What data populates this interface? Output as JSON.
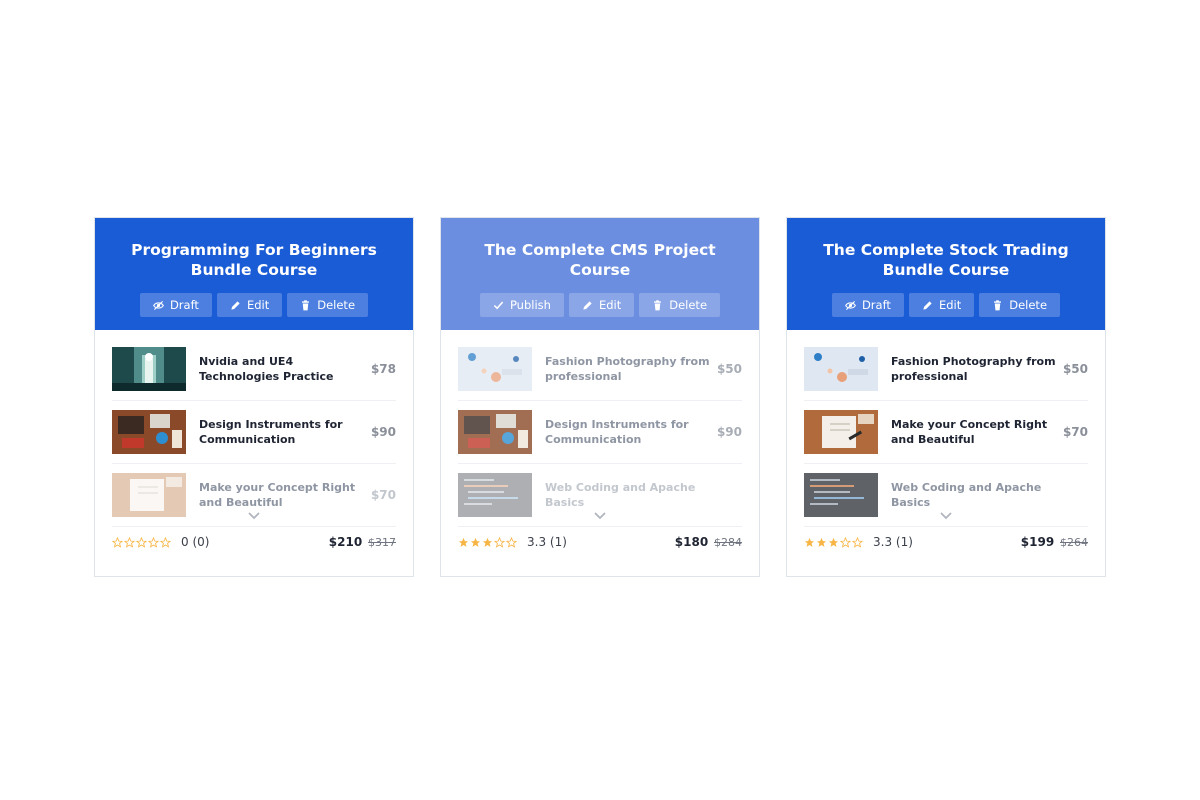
{
  "colors": {
    "primary": "#1a5bd6",
    "primary_light": "#6b8ee0",
    "star": "#f7b545"
  },
  "cards": [
    {
      "title": "Programming For Beginners Bundle Course",
      "header_color": "#1a5bd6",
      "actions": [
        {
          "icon": "eye-off-icon",
          "label": "Draft"
        },
        {
          "icon": "pencil-icon",
          "label": "Edit"
        },
        {
          "icon": "trash-icon",
          "label": "Delete"
        }
      ],
      "items": [
        {
          "title": "Nvidia and UE4 Technologies Practice",
          "price": "$78",
          "thumb": "tunnel"
        },
        {
          "title": "Design Instruments for Communication",
          "price": "$90",
          "thumb": "desk"
        },
        {
          "title": "Make your Concept Right and Beautiful",
          "price": "$70",
          "thumb": "notebook"
        }
      ],
      "rating_value": "0 (0)",
      "stars": 0,
      "price_now": "$210",
      "price_old": "$317"
    },
    {
      "title": "The Complete CMS Project Course",
      "header_color": "#6b8ee0",
      "actions": [
        {
          "icon": "check-icon",
          "label": "Publish"
        },
        {
          "icon": "pencil-icon",
          "label": "Edit"
        },
        {
          "icon": "trash-icon",
          "label": "Delete"
        }
      ],
      "items": [
        {
          "title": "Fashion Photography from professional",
          "price": "$50",
          "thumb": "fashion"
        },
        {
          "title": "Design Instruments for Communication",
          "price": "$90",
          "thumb": "desk"
        },
        {
          "title": "Web Coding and Apache Basics",
          "price": "",
          "thumb": "code"
        }
      ],
      "rating_value": "3.3 (1)",
      "stars": 3,
      "price_now": "$180",
      "price_old": "$284"
    },
    {
      "title": "The Complete Stock Trading Bundle Course",
      "header_color": "#1a5bd6",
      "actions": [
        {
          "icon": "eye-off-icon",
          "label": "Draft"
        },
        {
          "icon": "pencil-icon",
          "label": "Edit"
        },
        {
          "icon": "trash-icon",
          "label": "Delete"
        }
      ],
      "items": [
        {
          "title": "Fashion Photography from professional",
          "price": "$50",
          "thumb": "fashion"
        },
        {
          "title": "Make your Concept Right and Beautiful",
          "price": "$70",
          "thumb": "notebook"
        },
        {
          "title": "Web Coding and Apache Basics",
          "price": "",
          "thumb": "code"
        }
      ],
      "rating_value": "3.3 (1)",
      "stars": 3,
      "price_now": "$199",
      "price_old": "$264"
    }
  ]
}
